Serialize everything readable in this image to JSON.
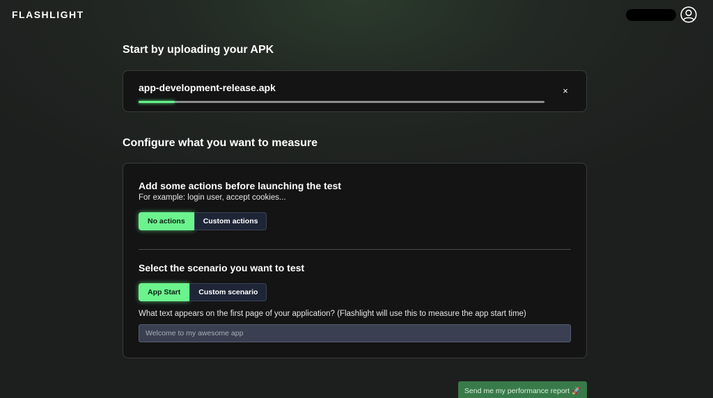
{
  "header": {
    "logo": "FLASHLIGHT",
    "user_icon": "user-circle-icon"
  },
  "upload": {
    "title": "Start by uploading your APK",
    "file_name": "app-development-release.apk",
    "close_label": "×",
    "progress": 0.09
  },
  "configure": {
    "title": "Configure what you want to measure",
    "actions": {
      "title": "Add some actions before launching the test",
      "subtitle": "For example: login user, accept cookies...",
      "options": [
        {
          "label": "No actions",
          "selected": true
        },
        {
          "label": "Custom actions",
          "selected": false
        }
      ]
    },
    "scenario": {
      "title": "Select the scenario you want to test",
      "options": [
        {
          "label": "App Start",
          "selected": true
        },
        {
          "label": "Custom scenario",
          "selected": false
        }
      ],
      "question": "What text appears on the first page of your application? (Flashlight will use this to measure the app start time)",
      "input_placeholder": "Welcome to my awesome app",
      "input_value": ""
    }
  },
  "footer": {
    "report_button": "Send me my performance report 🚀"
  },
  "colors": {
    "accent": "#6bf38d",
    "card_bg": "#141414",
    "report_button_bg": "#397a4a"
  }
}
